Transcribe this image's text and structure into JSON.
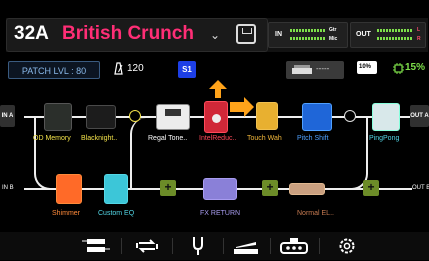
{
  "preset": {
    "number": "32A",
    "name": "British Crunch",
    "name_color": "#ff2e76"
  },
  "meters": {
    "in_label": "IN",
    "in_ch1": "Gtr",
    "in_ch2": "Mic",
    "out_label": "OUT",
    "out_ch1": "L",
    "out_ch2": "R"
  },
  "patch_level": "PATCH LVL : 80",
  "tempo": "120",
  "scene": "S1",
  "tuner_display": "-----",
  "battery": "10%",
  "cpu_usage": "15%",
  "chain_a": {
    "input_label": "IN A",
    "output_label": "OUT A",
    "blocks": [
      {
        "label": "OD Memory",
        "color": "#f3e24a"
      },
      {
        "label": "Blacknight..",
        "color": "#f3e24a"
      },
      {
        "label": "Regal Tone..",
        "color": "#ffffff"
      },
      {
        "label": "IntelReduc..",
        "color": "#ff4a5a"
      },
      {
        "label": "Touch Wah",
        "color": "#f0b63a"
      },
      {
        "label": "Pitch Shift",
        "color": "#4fa0ff"
      },
      {
        "label": "PingPong",
        "color": "#53d7e6"
      }
    ]
  },
  "chain_b": {
    "input_label": "IN B",
    "output_label": "OUT B",
    "blocks": [
      {
        "label": "Shimmer",
        "color": "#ff8a3a"
      },
      {
        "label": "Custom EQ",
        "color": "#53d7e6"
      },
      {
        "label": "FX RETURN",
        "color": "#a89cf0"
      },
      {
        "label": "Normal EL..",
        "color": "#c87c52"
      }
    ]
  },
  "add_symbol": "+",
  "bottom_bar": {
    "icons": [
      "routing-icon",
      "loop-icon",
      "tuner-fork-icon",
      "expression-pedal-icon",
      "footswitch-icon",
      "settings-icon"
    ]
  }
}
